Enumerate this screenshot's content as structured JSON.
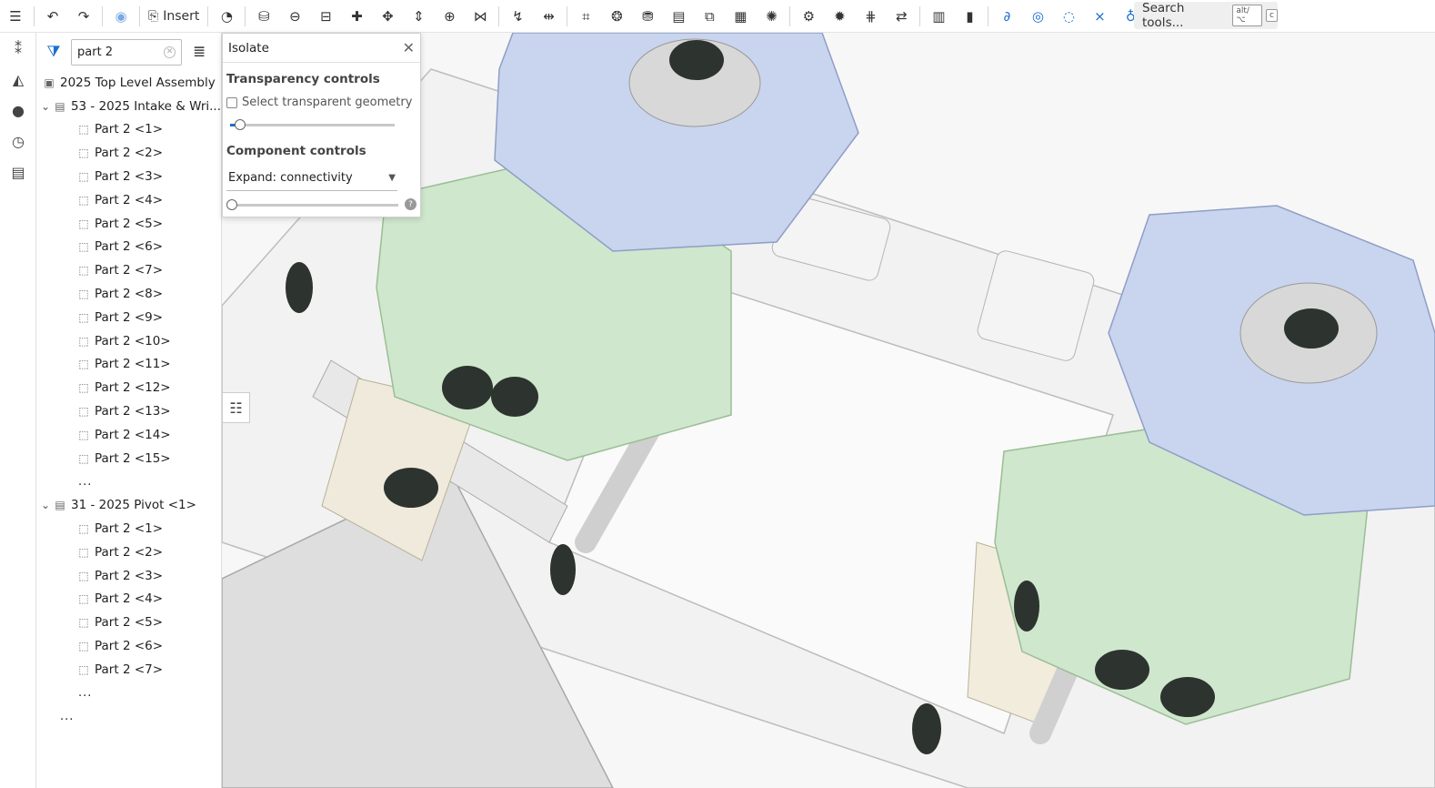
{
  "toolbar": {
    "insert_label": "Insert",
    "search_label": "Search tools...",
    "search_shortcut": "alt/⌥",
    "search_shortcut_key": "c"
  },
  "tree": {
    "filter_value": "part 2",
    "root_label": "2025 Top Level Assembly",
    "groups": [
      {
        "label": "53 - 2025 Intake & Wri...",
        "parts": [
          "Part 2 <1>",
          "Part 2 <2>",
          "Part 2 <3>",
          "Part 2 <4>",
          "Part 2 <5>",
          "Part 2 <6>",
          "Part 2 <7>",
          "Part 2 <8>",
          "Part 2 <9>",
          "Part 2 <10>",
          "Part 2 <11>",
          "Part 2 <12>",
          "Part 2 <13>",
          "Part 2 <14>",
          "Part 2 <15>"
        ],
        "more": "..."
      },
      {
        "label": "31 - 2025 Pivot <1>",
        "parts": [
          "Part 2 <1>",
          "Part 2 <2>",
          "Part 2 <3>",
          "Part 2 <4>",
          "Part 2 <5>",
          "Part 2 <6>",
          "Part 2 <7>"
        ],
        "more": "..."
      }
    ],
    "root_more": "..."
  },
  "isolate": {
    "title": "Isolate",
    "transparency_heading": "Transparency controls",
    "select_transparent_label": "Select transparent geometry",
    "transparency_level": 0.05,
    "component_heading": "Component controls",
    "expand_value": "Expand: connectivity",
    "expand_level": 0.0
  },
  "colors": {
    "accent": "#1a6fd0",
    "wheel_blue": "#c9d4ee",
    "wheel_green": "#cfe7cc",
    "part_dark": "#2d332f"
  }
}
